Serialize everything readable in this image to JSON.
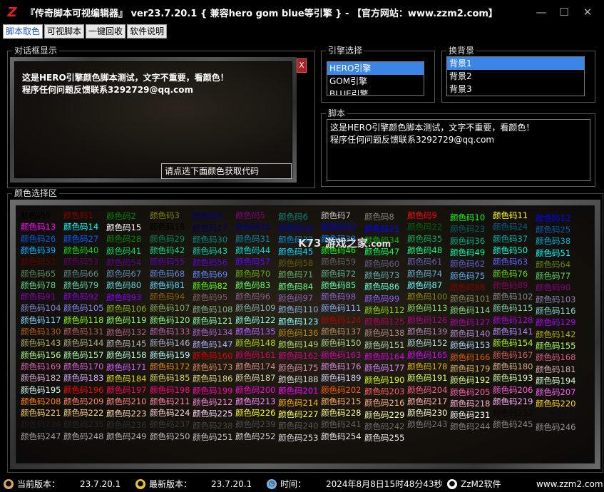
{
  "window": {
    "title": "『传奇脚本可视编辑器』    ver23.7.20.1      { 兼容hero gom blue等引擎 } - 【官方网站：www.zzm2.com】",
    "logo": "Z",
    "minimize": "—",
    "maximize": "☐",
    "close": "✕"
  },
  "tabs": [
    "脚本取色",
    "可视脚本",
    "一键回收",
    "软件说明"
  ],
  "dialog": {
    "legend": "对话框显示",
    "lines": [
      "这是HERO引擎颜色脚本测试，文字不重要，看颜色！",
      "程序任何问题反馈联系3292729@qq.com"
    ],
    "button": "请点选下面颜色获取代码",
    "close": "X"
  },
  "engine": {
    "legend": "引擎选择",
    "items": [
      "HERO引擎",
      "GOM引擎",
      "BLUE引擎"
    ],
    "selected": 0
  },
  "background": {
    "legend": "换背景",
    "items": [
      "背景1",
      "背景2",
      "背景3"
    ],
    "selected": 0
  },
  "script": {
    "legend": "脚本",
    "lines": [
      "这是HERO引擎颜色脚本测试，文字不重要，看颜色！",
      "程序任何问题反馈联系3292729@qq.com"
    ]
  },
  "colors": {
    "legend": "颜色选择区",
    "prefix": "颜色码",
    "palette": [
      "#000000",
      "#800000",
      "#008000",
      "#808000",
      "#000080",
      "#800080",
      "#008080",
      "#c0c0c0",
      "#808080",
      "#ff0000",
      "#00ff00",
      "#ffff00",
      "#0000ff",
      "#ff00ff",
      "#00ffff",
      "#ffffff"
    ]
  },
  "watermark": {
    "text": "K73 游戏之家",
    "sub": ".com"
  },
  "status": {
    "current_label": "当前版本：",
    "current": "23.7.20.1",
    "latest_label": "最新版本：",
    "latest": "23.7.20.1",
    "time_label": "时间：",
    "time": "2024年8月8日15时48分43秒",
    "brand": "ZzM2软件",
    "site": "www.zzm2.com"
  }
}
